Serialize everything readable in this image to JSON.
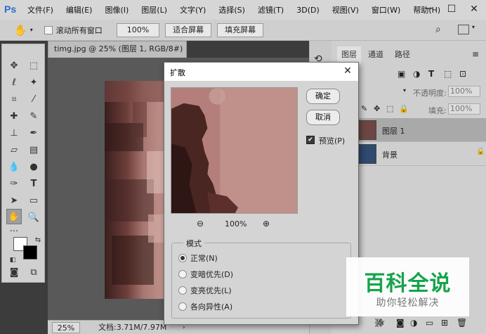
{
  "app": {
    "logo": "Ps",
    "menu": [
      "文件(F)",
      "编辑(E)",
      "图像(I)",
      "图层(L)",
      "文字(Y)",
      "选择(S)",
      "滤镜(T)",
      "3D(D)",
      "视图(V)",
      "窗口(W)",
      "帮助(H)"
    ]
  },
  "options": {
    "scroll_all_windows": "滚动所有窗口",
    "zoom_value": "100%",
    "fit_screen": "适合屏幕",
    "fill_screen": "填充屏幕"
  },
  "document": {
    "tab_title": "timg.jpg @ 25% (图层 1, RGB/8#) *",
    "zoom": "25%",
    "doc_info": "文档:3.71M/7.97M"
  },
  "layers_panel": {
    "tabs": [
      "图层",
      "通道",
      "路径"
    ],
    "opacity_label": "不透明度:",
    "opacity_value": "100%",
    "fill_label": "填充:",
    "fill_value": "100%",
    "layers": [
      "图层 1",
      "背景"
    ]
  },
  "dialog": {
    "title": "扩散",
    "ok": "确定",
    "cancel": "取消",
    "preview_label": "预览(P)",
    "preview_checked": true,
    "zoom": "100%",
    "mode_label": "模式",
    "modes": [
      "正常(N)",
      "变暗优先(D)",
      "变亮优先(L)",
      "各向异性(A)"
    ],
    "selected_mode": 0
  },
  "watermark": {
    "title": "百科全说",
    "subtitle": "助你轻松解决",
    "color": "#16a34a"
  }
}
